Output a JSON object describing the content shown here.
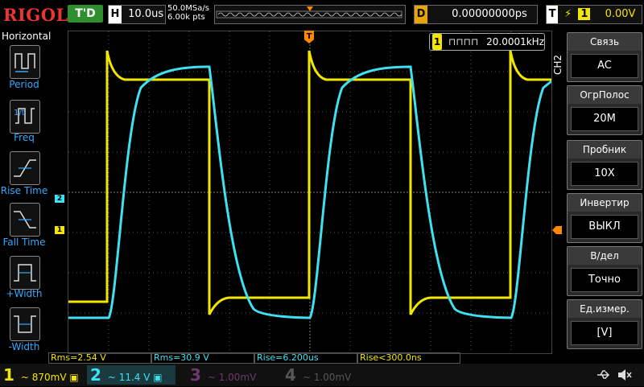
{
  "brand": "RIGOL",
  "trigger_status": "T'D",
  "horizontal": {
    "label": "H",
    "scale": "10.0us"
  },
  "sample": {
    "rate": "50.0MSa/s",
    "points": "6.00k pts"
  },
  "delay": {
    "label": "D",
    "value": "0.00000000ps"
  },
  "trigger": {
    "label": "T",
    "channel": "1",
    "level": "0.00V"
  },
  "left_menu": {
    "title": "Horizontal",
    "items": [
      {
        "label": "Period",
        "icon": "period-icon"
      },
      {
        "label": "Freq",
        "icon": "freq-icon"
      },
      {
        "label": "Rise Time",
        "icon": "rise-time-icon"
      },
      {
        "label": "Fall Time",
        "icon": "fall-time-icon"
      },
      {
        "label": "+Width",
        "icon": "pos-width-icon"
      },
      {
        "label": "-Width",
        "icon": "neg-width-icon"
      }
    ]
  },
  "freq_counter": {
    "channel": "1",
    "value": "20.0001kHz"
  },
  "right_menu": {
    "channel_tab": "CH2",
    "items": [
      {
        "title": "Связь",
        "value": "AC"
      },
      {
        "title": "ОгрПолос",
        "value": "20M"
      },
      {
        "title": "Пробник",
        "value": "10X"
      },
      {
        "title": "Инвертир",
        "value": "ВЫКЛ"
      },
      {
        "title": "В/дел",
        "value": "Точно"
      },
      {
        "title": "Ед.измер.",
        "value": "[V]"
      }
    ]
  },
  "measurements": [
    {
      "text": "Rms=2.54 V",
      "color": "#f2e600"
    },
    {
      "text": "Rms=30.9 V",
      "color": "#3fe0f0"
    },
    {
      "text": "Rise=6.200us",
      "color": "#3fe0f0"
    },
    {
      "text": "Rise<300.0ns",
      "color": "#f2e600"
    }
  ],
  "channels": [
    {
      "num": "1",
      "coupling": "~",
      "scale": "870mV",
      "color": "#f2e600",
      "active": true
    },
    {
      "num": "2",
      "coupling": "~",
      "scale": "11.4 V",
      "color": "#3fe0f0",
      "active": true
    },
    {
      "num": "3",
      "coupling": "~",
      "scale": "1.00mV",
      "color": "#c040c0",
      "active": false
    },
    {
      "num": "4",
      "coupling": "~",
      "scale": "1.00mV",
      "color": "#5a7aff",
      "active": false
    }
  ],
  "ch1_marker": "1",
  "ch2_marker": "2",
  "colors": {
    "ch1": "#f2e600",
    "ch2": "#3fe0f0",
    "trigger": "#ff8800"
  }
}
